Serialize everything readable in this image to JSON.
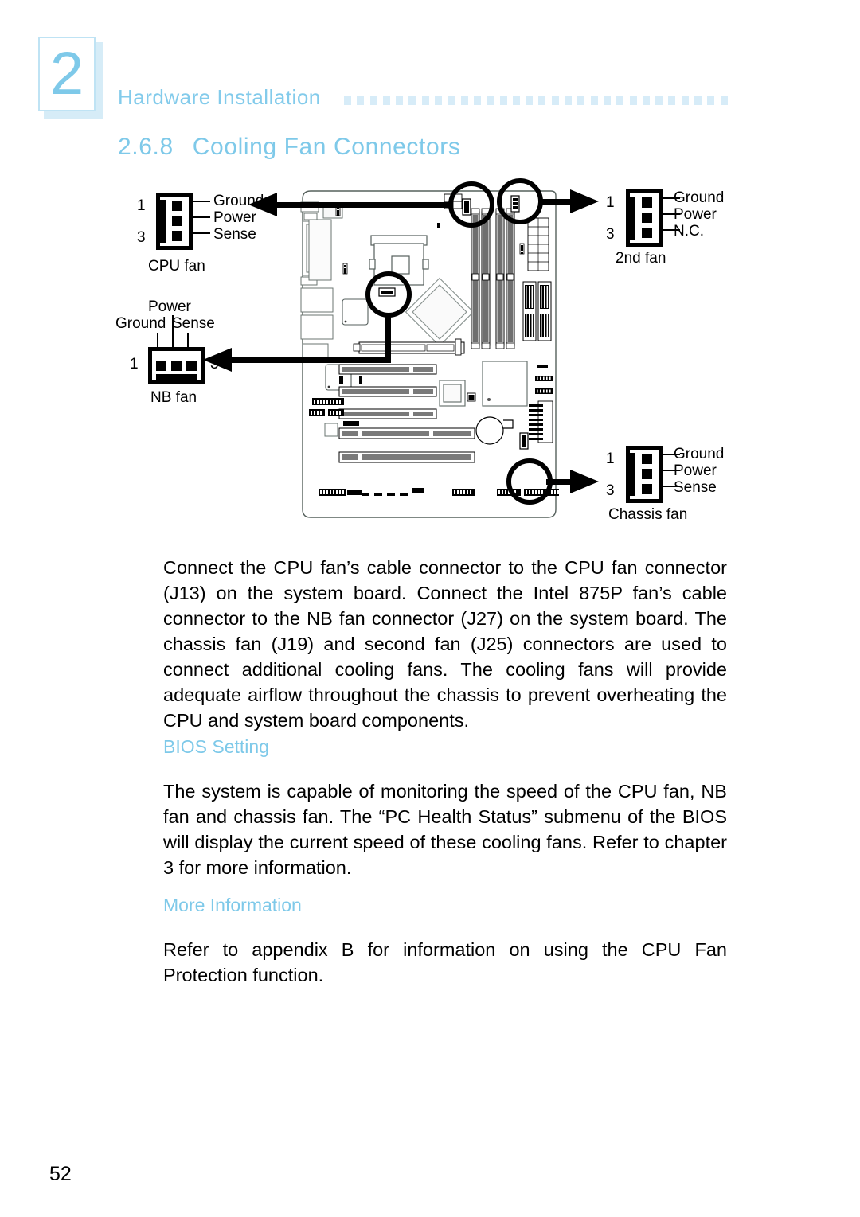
{
  "header": {
    "chapter_number": "2",
    "title": "Hardware Installation",
    "accent_color": "#7ec9e9",
    "dot_color": "#d7ecf8"
  },
  "section": {
    "number": "2.6.8",
    "title": "Cooling Fan Connectors"
  },
  "figure": {
    "connectors": [
      {
        "id": "cpu-fan",
        "name": "CPU fan",
        "pin_first": "1",
        "pin_last": "3",
        "labels": [
          "Ground",
          "Power",
          "Sense"
        ]
      },
      {
        "id": "nb-fan",
        "name": "NB fan",
        "pin_first": "1",
        "pin_last": "3",
        "labels": [
          "Ground",
          "Power",
          "Sense"
        ]
      },
      {
        "id": "second-fan",
        "name": "2nd fan",
        "pin_first": "1",
        "pin_last": "3",
        "labels": [
          "Ground",
          "Power",
          "N.C."
        ]
      },
      {
        "id": "chassis-fan",
        "name": "Chassis fan",
        "pin_first": "1",
        "pin_last": "3",
        "labels": [
          "Ground",
          "Power",
          "Sense"
        ]
      }
    ]
  },
  "body": {
    "paragraph1": "Connect the CPU fan’s cable connector to the CPU fan connector (J13) on the system board. Connect the Intel 875P fan’s cable connector to the NB fan connector (J27) on the system board. The chassis fan (J19) and second fan (J25) connectors are used to connect additional cooling fans. The cooling fans will provide adequate airflow throughout the chassis to prevent overheating the CPU and system board components.",
    "bios_heading": "BIOS Setting",
    "paragraph2": "The system is capable of monitoring the speed of the CPU fan, NB fan and chassis fan. The “PC Health Status” submenu of the BIOS will display the current speed of these cooling fans. Refer to chapter 3 for more information.",
    "more_info_heading": "More Information",
    "paragraph3": "Refer to appendix B for information on using the CPU Fan Protection function."
  },
  "footer": {
    "page_number": "52"
  }
}
